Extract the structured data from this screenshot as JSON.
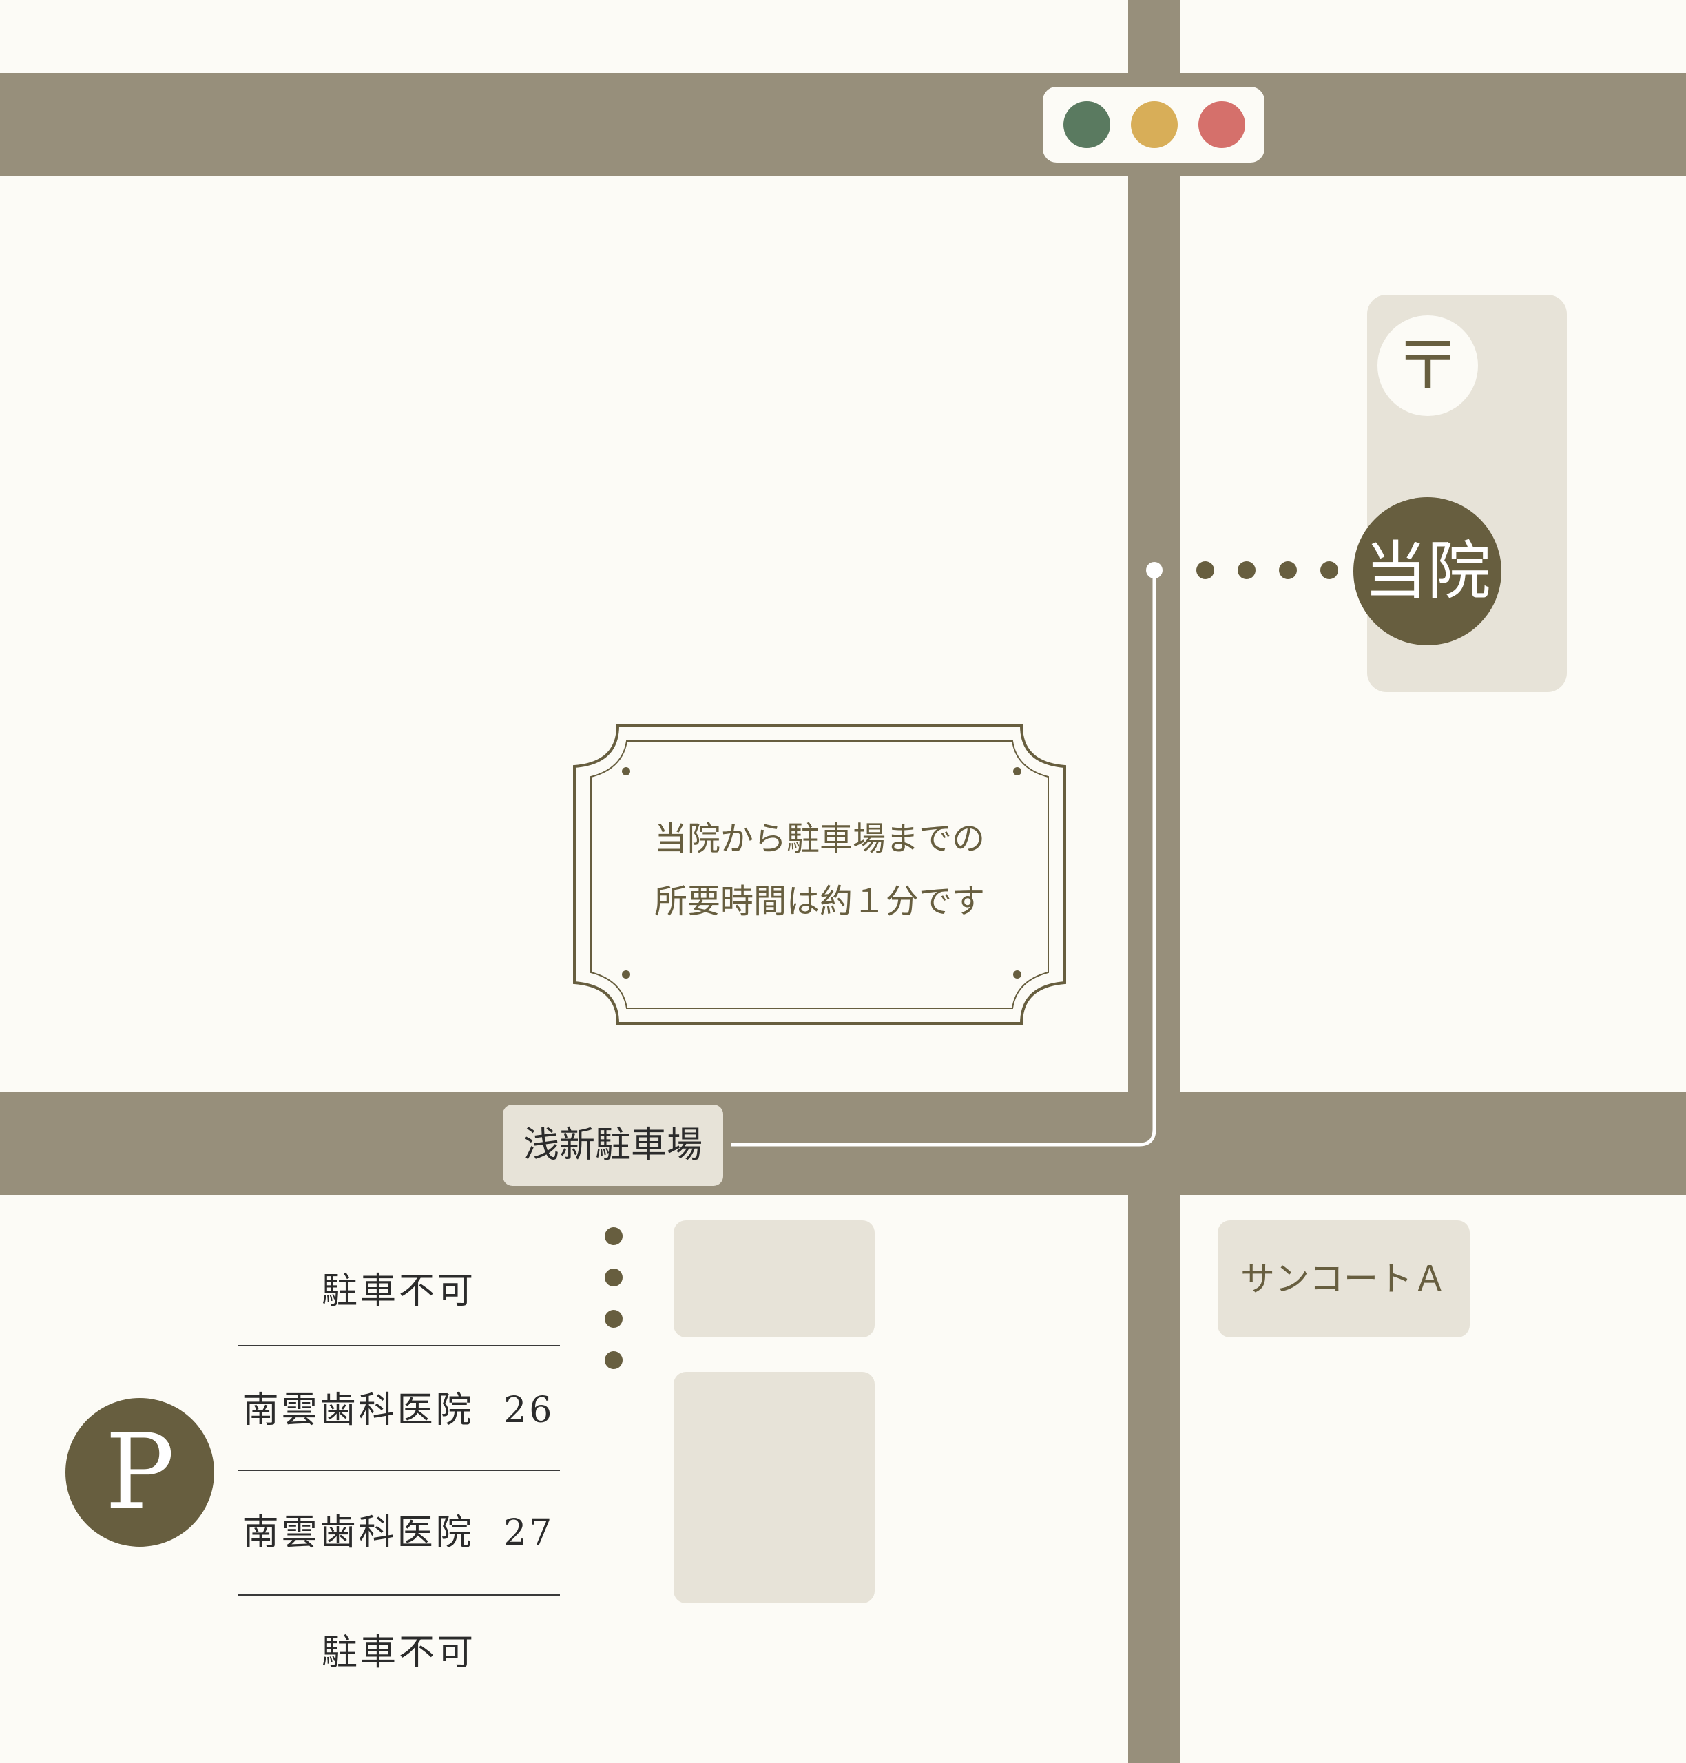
{
  "colors": {
    "background": "#fcfbf6",
    "road": "#978f7b",
    "block": "#e7e3d8",
    "brand": "#675e3f",
    "signal_green": "#5a7a60",
    "signal_yellow": "#d8ae58",
    "signal_red": "#d5706b"
  },
  "clinic": {
    "label": "当院"
  },
  "post_office": {
    "icon": "post-office-icon",
    "symbol": "〒"
  },
  "notice": {
    "line1": "当院から駐車場までの",
    "line2": "所要時間は約１分です"
  },
  "parking": {
    "name": "浅新駐車場",
    "icon_label": "P",
    "slots": [
      {
        "label": "駐車不可"
      },
      {
        "label": "南雲歯科医院",
        "number": "26"
      },
      {
        "label": "南雲歯科医院",
        "number": "27"
      },
      {
        "label": "駐車不可"
      }
    ]
  },
  "landmarks": {
    "building": "サンコートＡ"
  },
  "traffic_signal": {
    "icon": "traffic-light-icon",
    "lights": [
      "green",
      "yellow",
      "red"
    ]
  }
}
